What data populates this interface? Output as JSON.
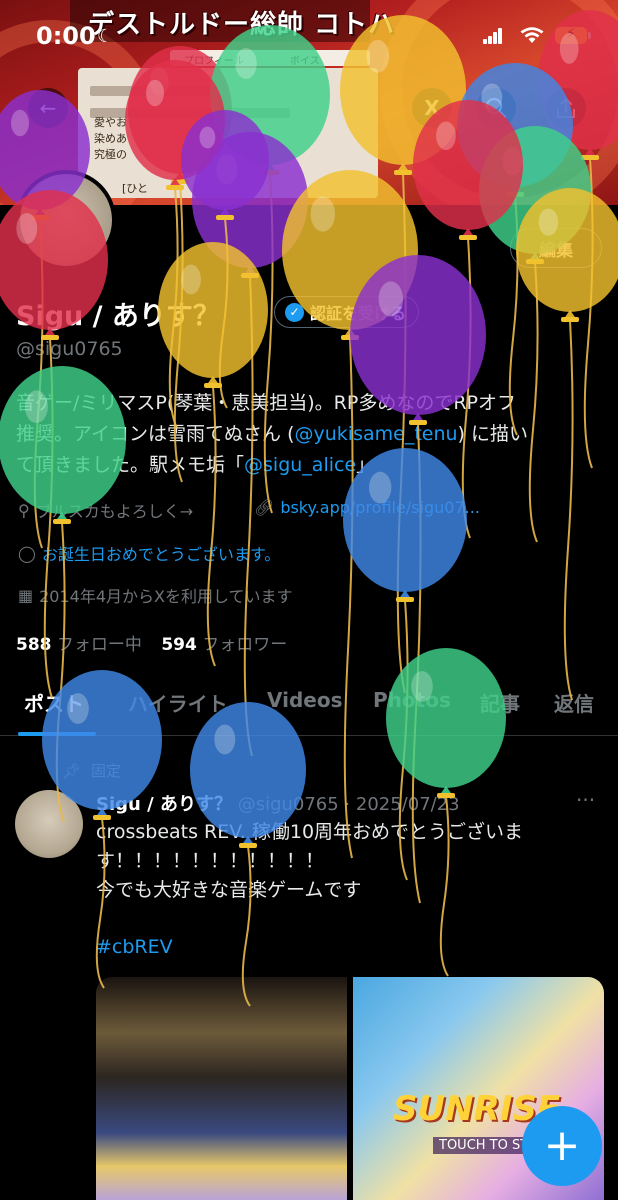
{
  "status_bar": {
    "time": "0:00",
    "battery_color": "#f5c518"
  },
  "banner": {
    "title": "デストルドー総帥 コトハ",
    "tab_profile": "プロフィール",
    "tab_voice": "ボイス",
    "text_1": "愛やお",
    "text_2": "染めあ",
    "text_3": "究極の",
    "text_4": "[ひと"
  },
  "nav": {
    "back_icon": "arrow-left-icon",
    "grok_icon": "grok-icon",
    "search_icon": "search-icon",
    "share_icon": "share-icon"
  },
  "profile": {
    "edit_label": "編集",
    "name": "Sigu / ありす？",
    "verify_label": "認証を受ける",
    "handle": "@sigu0765",
    "bio_line_1": "音ゲー/ミリマスP(琴葉・恵美担当)。RP多めなのでRPオフ",
    "bio_line_2_a": "推奨。アイコンは雪雨てぬさん (",
    "bio_line_2_link": "@yukisame_tenu",
    "bio_line_2_b": ") に描い",
    "bio_line_3_a": "て頂きました。駅メモ垢「",
    "bio_line_3_link": "@sigu_alice",
    "bio_line_3_b": "」",
    "location": "ブルスカもよろしく→",
    "website": "bsky.app/profile/sigu07...",
    "birthday": "お誕生日おめでとうございます。",
    "joined": "2014年4月からXを利用しています",
    "following_count": "588",
    "following_label": "フォロー中",
    "followers_count": "594",
    "followers_label": "フォロワー"
  },
  "tabs": [
    "ポスト",
    "ハイライト",
    "Videos",
    "Photos",
    "記事",
    "返信"
  ],
  "post": {
    "pinned_label": "固定",
    "author": "Sigu / ありす？",
    "handle_date": "@sigu0765 · 2025/07/23",
    "more_label": "···",
    "text_line_1": "crossbeats REV. 稼働10周年おめでとうございま",
    "text_line_2": "す！！！！！！！！！！！",
    "text_line_3": "今でも大好きな音楽ゲームです",
    "hashtag": "#cbREV",
    "media_logo": "SUNRISE",
    "media_touch": "TOUCH TO START"
  },
  "fab": {
    "label": "+"
  },
  "balloon_colors": {
    "purple": "#8a2fd0",
    "red": "#e0304a",
    "yellow": "#f2c12e",
    "green": "#3fd18a",
    "blue": "#3f88e6"
  }
}
